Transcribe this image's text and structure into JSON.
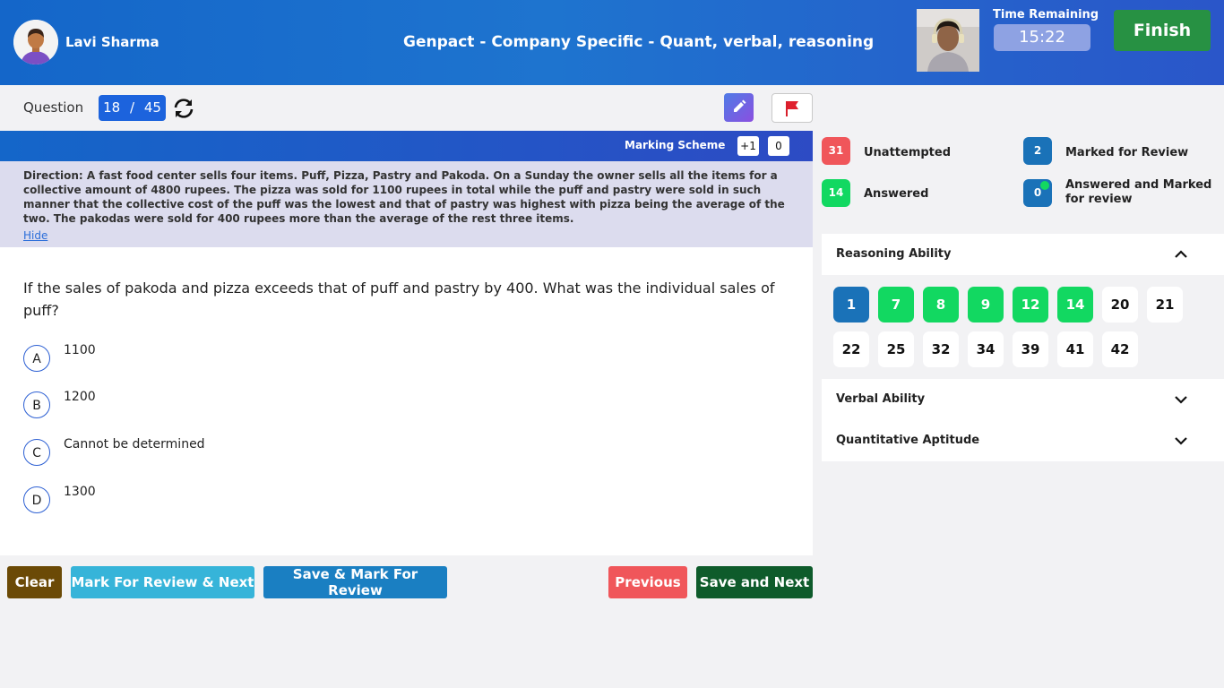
{
  "header": {
    "user_name": "Lavi Sharma",
    "exam_title": "Genpact - Company Specific - Quant, verbal, reasoning",
    "time_label": "Time Remaining",
    "time_value": "15:22",
    "finish_label": "Finish"
  },
  "question_bar": {
    "label": "Question",
    "current": "18",
    "separator": "/",
    "total": "45"
  },
  "marking_scheme": {
    "label": "Marking Scheme",
    "positive": "+1",
    "negative": "0"
  },
  "direction": {
    "text": "Direction: A fast food center sells four items. Puff, Pizza, Pastry and Pakoda. On a Sunday the owner sells all the items for a collective amount of 4800 rupees. The pizza was sold for 1100 rupees in total while the puff and pastry were sold in such manner that the collective cost of the puff was the lowest and that of pastry was highest with pizza being the average of the two. The pakodas were sold for 400 rupees more than the average of the rest three items.",
    "hide_label": "Hide"
  },
  "question": {
    "text": "If the sales of pakoda and pizza exceeds that of puff and pastry by 400. What was the individual sales of puff?",
    "options": [
      {
        "letter": "A",
        "text": "1100"
      },
      {
        "letter": "B",
        "text": "1200"
      },
      {
        "letter": "C",
        "text": "Cannot be determined"
      },
      {
        "letter": "D",
        "text": "1300"
      }
    ]
  },
  "buttons": {
    "clear": "Clear",
    "mark_review_next": "Mark For Review & Next",
    "save_mark_review": "Save & Mark For Review",
    "previous": "Previous",
    "save_next": "Save and Next"
  },
  "legend": {
    "unattempted": {
      "count": "31",
      "label": "Unattempted"
    },
    "marked_review": {
      "count": "2",
      "label": "Marked for Review"
    },
    "answered": {
      "count": "14",
      "label": "Answered"
    },
    "answered_marked": {
      "count": "0",
      "label": "Answered and Marked for review"
    }
  },
  "sections": [
    {
      "title": "Reasoning Ability",
      "expanded": true,
      "questions": [
        {
          "n": "1",
          "state": "current"
        },
        {
          "n": "7",
          "state": "answered"
        },
        {
          "n": "8",
          "state": "answered"
        },
        {
          "n": "9",
          "state": "answered"
        },
        {
          "n": "12",
          "state": "answered"
        },
        {
          "n": "14",
          "state": "answered"
        },
        {
          "n": "20",
          "state": "unattempted"
        },
        {
          "n": "21",
          "state": "unattempted"
        },
        {
          "n": "22",
          "state": "unattempted"
        },
        {
          "n": "25",
          "state": "unattempted"
        },
        {
          "n": "32",
          "state": "unattempted"
        },
        {
          "n": "34",
          "state": "unattempted"
        },
        {
          "n": "39",
          "state": "unattempted"
        },
        {
          "n": "41",
          "state": "unattempted"
        },
        {
          "n": "42",
          "state": "unattempted"
        }
      ]
    },
    {
      "title": "Verbal Ability",
      "expanded": false
    },
    {
      "title": "Quantitative Aptitude",
      "expanded": false
    }
  ],
  "colors": {
    "header_start": "#1466c9",
    "finish": "#279143",
    "answered": "#12d861",
    "unattempted_badge": "#f0565a",
    "marked": "#1a72b8",
    "clear": "#6b4a06",
    "mark_review_next": "#36b4d9",
    "save_mark_review": "#1a7fc2",
    "previous": "#f0565a",
    "save_next": "#0e5b2b"
  }
}
